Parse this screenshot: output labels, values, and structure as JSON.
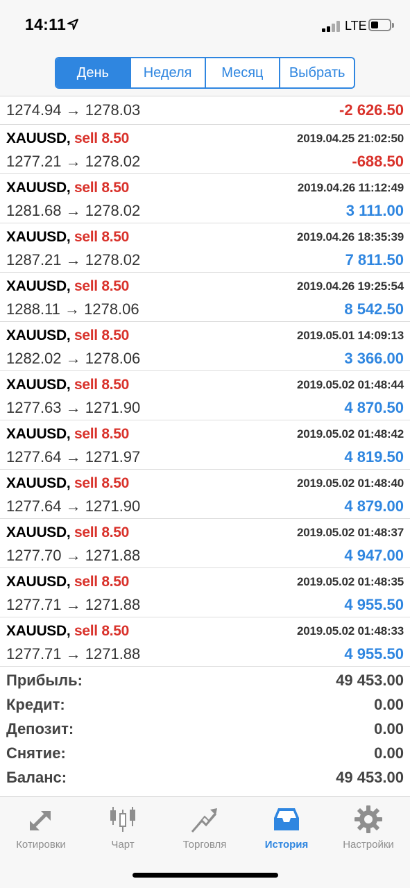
{
  "status": {
    "time": "14:11",
    "network": "LTE"
  },
  "segments": [
    {
      "label": "День",
      "active": true
    },
    {
      "label": "Неделя",
      "active": false
    },
    {
      "label": "Месяц",
      "active": false
    },
    {
      "label": "Выбрать",
      "active": false
    }
  ],
  "partial_row": {
    "prices": "1274.94 → 1278.03",
    "profit": "-2 626.50"
  },
  "trades": [
    {
      "symbol": "XAUUSD",
      "side": "sell",
      "volume": "8.50",
      "date": "2019.04.25 21:02:50",
      "prices": "1277.21 → 1278.02",
      "profit": "-688.50",
      "negative": true
    },
    {
      "symbol": "XAUUSD",
      "side": "sell",
      "volume": "8.50",
      "date": "2019.04.26 11:12:49",
      "prices": "1281.68 → 1278.02",
      "profit": "3 111.00",
      "negative": false
    },
    {
      "symbol": "XAUUSD",
      "side": "sell",
      "volume": "8.50",
      "date": "2019.04.26 18:35:39",
      "prices": "1287.21 → 1278.02",
      "profit": "7 811.50",
      "negative": false
    },
    {
      "symbol": "XAUUSD",
      "side": "sell",
      "volume": "8.50",
      "date": "2019.04.26 19:25:54",
      "prices": "1288.11 → 1278.06",
      "profit": "8 542.50",
      "negative": false
    },
    {
      "symbol": "XAUUSD",
      "side": "sell",
      "volume": "8.50",
      "date": "2019.05.01 14:09:13",
      "prices": "1282.02 → 1278.06",
      "profit": "3 366.00",
      "negative": false
    },
    {
      "symbol": "XAUUSD",
      "side": "sell",
      "volume": "8.50",
      "date": "2019.05.02 01:48:44",
      "prices": "1277.63 → 1271.90",
      "profit": "4 870.50",
      "negative": false
    },
    {
      "symbol": "XAUUSD",
      "side": "sell",
      "volume": "8.50",
      "date": "2019.05.02 01:48:42",
      "prices": "1277.64 → 1271.97",
      "profit": "4 819.50",
      "negative": false
    },
    {
      "symbol": "XAUUSD",
      "side": "sell",
      "volume": "8.50",
      "date": "2019.05.02 01:48:40",
      "prices": "1277.64 → 1271.90",
      "profit": "4 879.00",
      "negative": false
    },
    {
      "symbol": "XAUUSD",
      "side": "sell",
      "volume": "8.50",
      "date": "2019.05.02 01:48:37",
      "prices": "1277.70 → 1271.88",
      "profit": "4 947.00",
      "negative": false
    },
    {
      "symbol": "XAUUSD",
      "side": "sell",
      "volume": "8.50",
      "date": "2019.05.02 01:48:35",
      "prices": "1277.71 → 1271.88",
      "profit": "4 955.50",
      "negative": false
    },
    {
      "symbol": "XAUUSD",
      "side": "sell",
      "volume": "8.50",
      "date": "2019.05.02 01:48:33",
      "prices": "1277.71 → 1271.88",
      "profit": "4 955.50",
      "negative": false
    }
  ],
  "summary": [
    {
      "label": "Прибыль:",
      "value": "49 453.00"
    },
    {
      "label": "Кредит:",
      "value": "0.00"
    },
    {
      "label": "Депозит:",
      "value": "0.00"
    },
    {
      "label": "Снятие:",
      "value": "0.00"
    },
    {
      "label": "Баланс:",
      "value": "49 453.00"
    }
  ],
  "tabs": [
    {
      "label": "Котировки",
      "icon": "quotes-arrows-icon",
      "active": false
    },
    {
      "label": "Чарт",
      "icon": "candlestick-chart-icon",
      "active": false
    },
    {
      "label": "Торговля",
      "icon": "trade-trend-icon",
      "active": false
    },
    {
      "label": "История",
      "icon": "history-tray-icon",
      "active": true
    },
    {
      "label": "Настройки",
      "icon": "settings-gear-icon",
      "active": false
    }
  ],
  "colors": {
    "accent": "#2f86e0",
    "negative": "#d9322b",
    "inactive": "#8e8e8e"
  }
}
